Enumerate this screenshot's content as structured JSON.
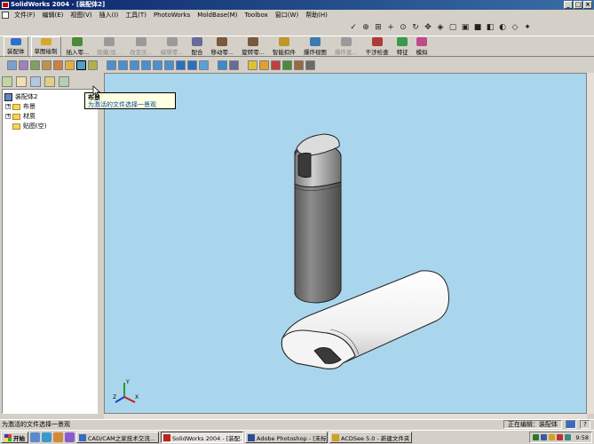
{
  "window": {
    "title": "SolidWorks 2004 - [装配体2]"
  },
  "menu": [
    "文件(F)",
    "编辑(E)",
    "视图(V)",
    "插入(I)",
    "工具(T)",
    "PhotoWorks",
    "MoldBase(M)",
    "Toolbox",
    "窗口(W)",
    "帮助(H)"
  ],
  "command_bar": {
    "items": [
      {
        "label": "装配体",
        "state": "active",
        "color": "#2f6fd0"
      },
      {
        "label": "草图绘制",
        "state": "active",
        "color": "#d7a82a"
      },
      {
        "label": "插入零...",
        "state": "normal",
        "color": "#4a8a3a"
      },
      {
        "label": "隐藏/显...",
        "state": "disabled",
        "color": "#9a9a9a"
      },
      {
        "label": "改变压...",
        "state": "disabled",
        "color": "#9a9a9a"
      },
      {
        "label": "编辑零...",
        "state": "disabled",
        "color": "#9a9a9a"
      },
      {
        "label": "配合",
        "state": "normal",
        "color": "#6a6a9a"
      },
      {
        "label": "移动零...",
        "state": "normal",
        "color": "#7a5a3a"
      },
      {
        "label": "旋转零...",
        "state": "normal",
        "color": "#7a5a3a"
      },
      {
        "label": "智能扣件",
        "state": "normal",
        "color": "#c0962a"
      },
      {
        "label": "爆炸视图",
        "state": "normal",
        "color": "#3a7ab0"
      },
      {
        "label": "爆炸直...",
        "state": "disabled",
        "color": "#9a9a9a"
      },
      {
        "label": "干涉检查",
        "state": "normal",
        "color": "#b03a3a"
      },
      {
        "label": "特征",
        "state": "normal",
        "color": "#3a9a4a"
      },
      {
        "label": "模拟",
        "state": "normal",
        "color": "#c04a8a"
      }
    ]
  },
  "top_tools": [
    "select-icon",
    "zoom-fit-icon",
    "zoom-area-icon",
    "zoom-in-icon",
    "zoom-select-icon",
    "rotate-icon",
    "pan-icon",
    "view-orient-icon",
    "wireframe-icon",
    "hidden-line-icon",
    "shaded-icon",
    "section-icon",
    "shadow-icon",
    "perspective-icon",
    "render-icon"
  ],
  "feature_tree": {
    "root": "装配体2",
    "items": [
      {
        "label": "布景",
        "expandable": true
      },
      {
        "label": "材质",
        "expandable": true
      },
      {
        "label": "贴图(空)",
        "expandable": false
      }
    ]
  },
  "tooltip": {
    "title": "布景",
    "description": "为激活的文件选择一景观"
  },
  "status": {
    "left": "为激活的文件选择一景观",
    "editing": "正在编辑：装配体"
  },
  "taskbar": {
    "start": "开始",
    "tasks": [
      {
        "label": "CAD/CAM之家技术交流...",
        "active": false,
        "color": "#3a6ac0"
      },
      {
        "label": "SolidWorks 2004 - [装配...",
        "active": true,
        "color": "#c02020"
      },
      {
        "label": "Adobe Photoshop - [未标...",
        "active": false,
        "color": "#2a4a9a"
      },
      {
        "label": "ACDSee 5.0 - 新建文件夹",
        "active": false,
        "color": "#d0a020"
      }
    ],
    "clock": "9:58"
  },
  "colors": {
    "viewport_bg": "#a9d6ec",
    "title_bar": "#0a246a",
    "tooltip_bg": "#ffffe1"
  }
}
